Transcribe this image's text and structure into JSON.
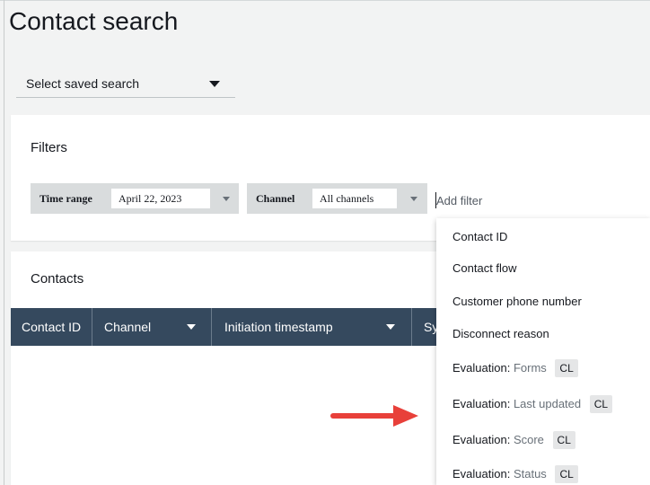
{
  "page": {
    "title": "Contact search"
  },
  "saved_search": {
    "label": "Select saved search"
  },
  "filters": {
    "title": "Filters",
    "time_range": {
      "label": "Time range",
      "value": "April 22, 2023"
    },
    "channel": {
      "label": "Channel",
      "value": "All channels"
    },
    "add_filter_placeholder": "Add filter"
  },
  "contacts": {
    "title": "Contacts",
    "columns": [
      {
        "label": "Contact ID"
      },
      {
        "label": "Channel"
      },
      {
        "label": "Initiation timestamp"
      },
      {
        "label": "Sy"
      }
    ]
  },
  "add_filter_menu": {
    "items": [
      {
        "label": "Contact ID"
      },
      {
        "label": "Contact flow"
      },
      {
        "label": "Customer phone number"
      },
      {
        "label": "Disconnect reason"
      },
      {
        "label": "Evaluation:",
        "sub": "Forms",
        "tag": "CL"
      },
      {
        "label": "Evaluation:",
        "sub": "Last updated",
        "tag": "CL"
      },
      {
        "label": "Evaluation:",
        "sub": "Score",
        "tag": "CL"
      },
      {
        "label": "Evaluation:",
        "sub": "Status",
        "tag": "CL"
      }
    ]
  },
  "colors": {
    "table_header": "#35495e",
    "arrow": "#e8403a",
    "background": "#f2f3f3"
  },
  "icons": {
    "arrow": "right-arrow-icon",
    "caret": "caret-down-icon"
  }
}
